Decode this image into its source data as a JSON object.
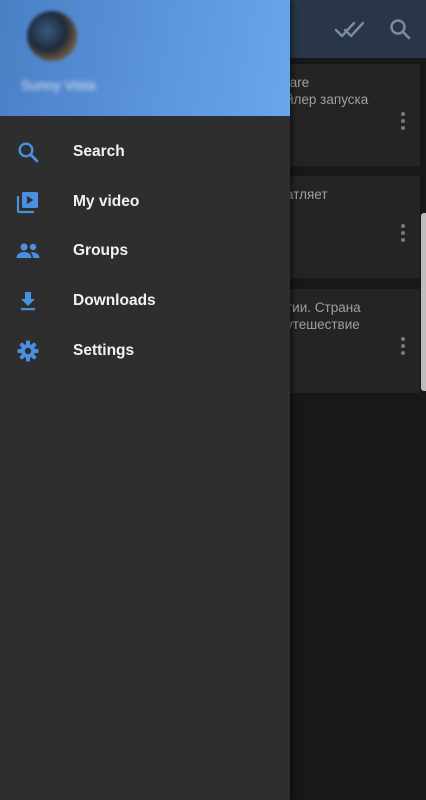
{
  "drawer": {
    "user_name": "Sunny Vista",
    "menu": [
      {
        "label": "Search",
        "icon": "search-icon"
      },
      {
        "label": "My video",
        "icon": "video-library-icon"
      },
      {
        "label": "Groups",
        "icon": "groups-icon"
      },
      {
        "label": "Downloads",
        "icon": "download-icon"
      },
      {
        "label": "Settings",
        "icon": "settings-gear-icon"
      }
    ]
  },
  "background": {
    "toolbar_icons": [
      "double-check-icon",
      "search-icon"
    ],
    "cards": [
      {
        "line1": "fare",
        "line2": "йлер запуска"
      },
      {
        "line1": "атляет",
        "line2": ""
      },
      {
        "line1": "тии. Страна",
        "line2": "утешествие"
      }
    ]
  },
  "colors": {
    "accent": "#4a90e2",
    "drawer_bg": "#2e2e2e",
    "toolbar_bg": "#2f3e52",
    "header_gradient_start": "#4a7fc4",
    "header_gradient_end": "#6aa6ea"
  }
}
